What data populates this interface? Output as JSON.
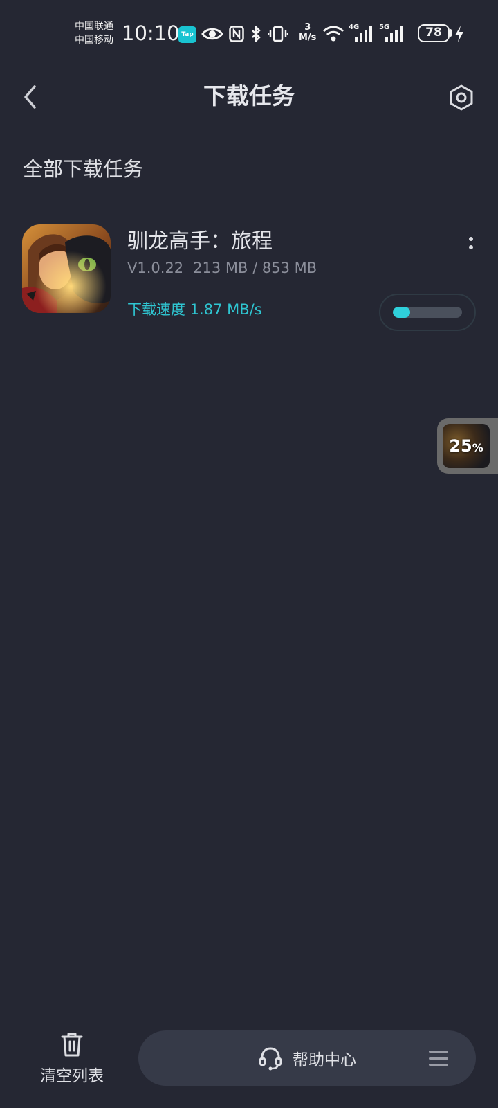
{
  "status_bar": {
    "carrier_1": "中国联通",
    "carrier_2": "中国移动",
    "time": "10:10",
    "tap_badge": "Tap",
    "net_speed_value": "3",
    "net_speed_unit": "M/s",
    "net_4g": "4G",
    "net_5g": "5G",
    "battery": "78",
    "icons": [
      "eye-icon",
      "nfc-icon",
      "bluetooth-icon",
      "vibrate-icon",
      "wifi-icon",
      "signal-icon",
      "charging-icon"
    ]
  },
  "header": {
    "title": "下载任务",
    "back_icon": "chevron-left-icon",
    "settings_icon": "settings-hexagon-icon"
  },
  "section": {
    "title": "全部下载任务"
  },
  "tasks": [
    {
      "name": "驯龙高手：旅程",
      "version": "V1.0.22",
      "size": "213 MB / 853 MB",
      "speed": "下载速度 1.87 MB/s",
      "progress": 0.25
    }
  ],
  "float_widget": {
    "percent": "25",
    "percent_sign": "%"
  },
  "bottom_bar": {
    "clear_label": "清空列表",
    "help_label": "帮助中心"
  },
  "colors": {
    "background": "#252733",
    "accent": "#2fc6d2",
    "pill": "#363a48"
  }
}
